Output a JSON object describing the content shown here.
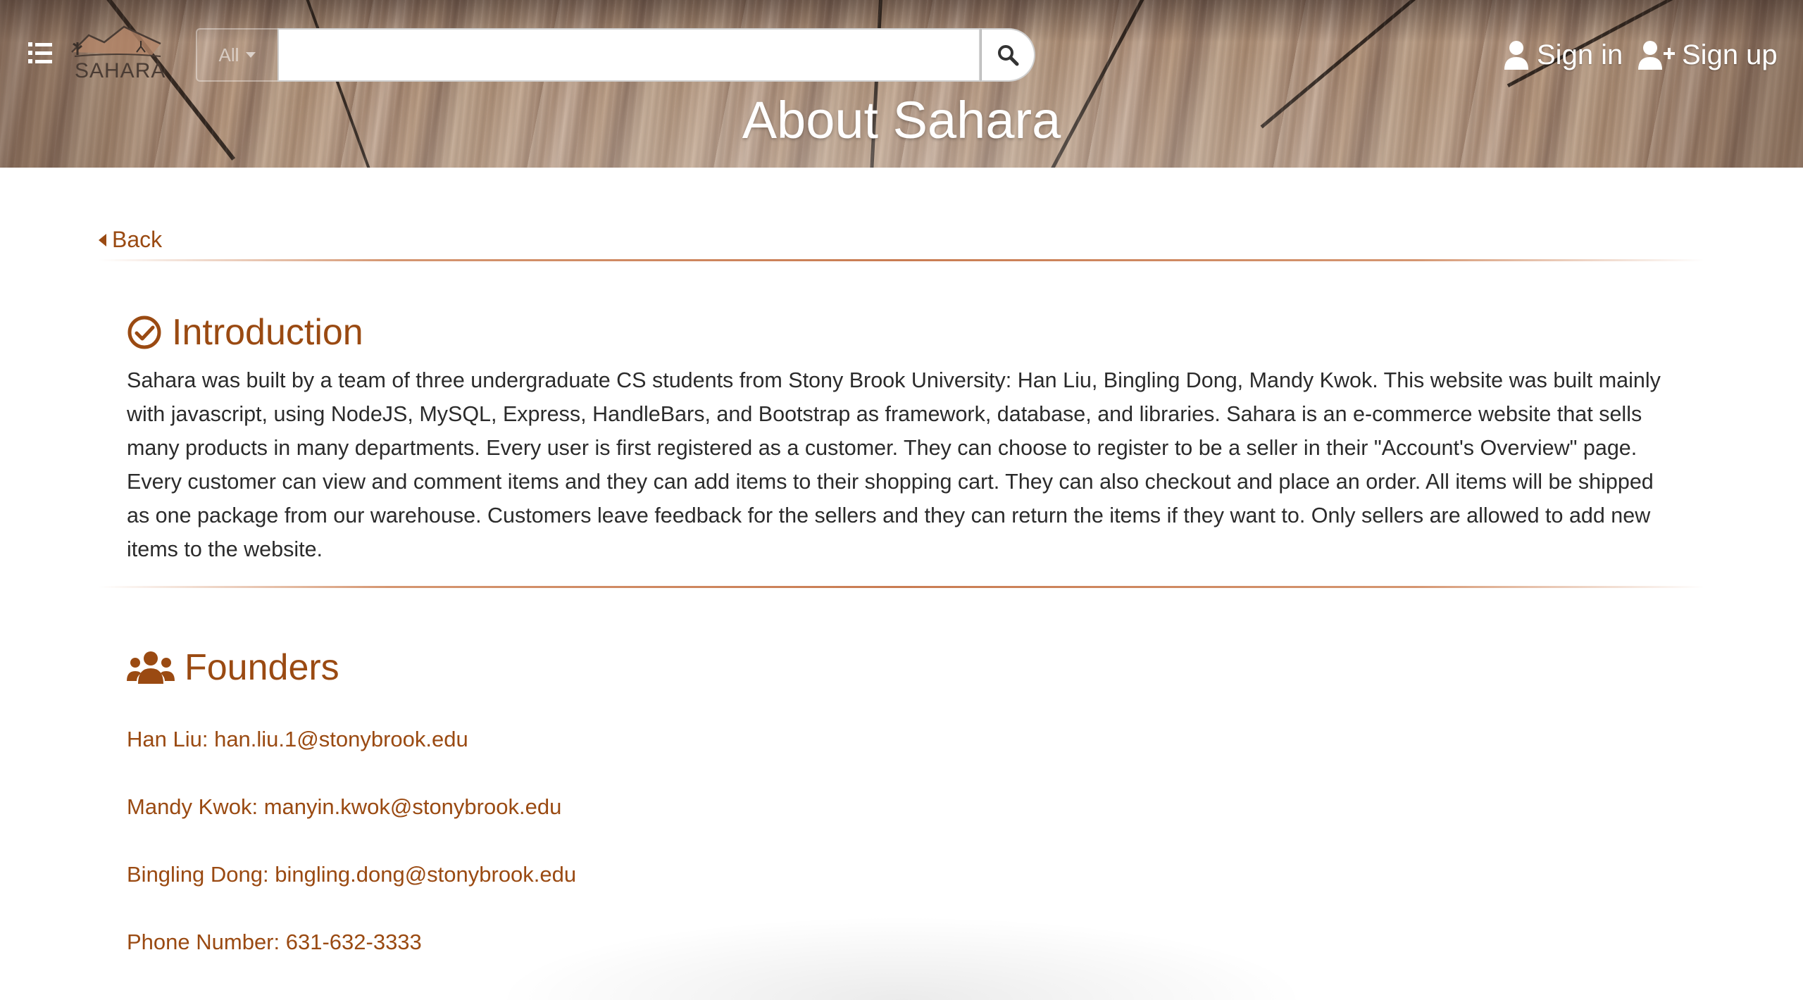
{
  "header": {
    "logo_text": "SAHARA",
    "department_select": {
      "selected": "All"
    },
    "search": {
      "value": "",
      "placeholder": ""
    },
    "sign_in_label": "Sign in",
    "sign_up_label": "Sign up",
    "page_title": "About Sahara"
  },
  "nav": {
    "back_label": "Back"
  },
  "introduction": {
    "heading": "Introduction",
    "body": "Sahara was built by a team of three undergraduate CS students from Stony Brook University: Han Liu, Bingling Dong, Mandy Kwok. This website was built mainly with javascript, using NodeJS, MySQL, Express, HandleBars, and Bootstrap as framework, database, and libraries. Sahara is an e-commerce website that sells many products in many departments. Every user is first registered as a customer. They can choose to register to be a seller in their \"Account's Overview\" page. Every customer can view and comment items and they can add items to their shopping cart. They can also checkout and place an order. All items will be shipped as one package from our warehouse. Customers leave feedback for the sellers and they can return the items if they want to. Only sellers are allowed to add new items to the website."
  },
  "founders": {
    "heading": "Founders",
    "lines": [
      "Han Liu: han.liu.1@stonybrook.edu",
      "Mandy Kwok: manyin.kwok@stonybrook.edu",
      "Bingling Dong: bingling.dong@stonybrook.edu",
      "Phone Number: 631-632-3333"
    ]
  },
  "colors": {
    "accent": "#9a4a12",
    "divider": "#c97c52",
    "body_text": "#2b2b2b",
    "header_text": "#ffffff"
  },
  "icons": {
    "menu": "list-icon",
    "search": "search-icon",
    "sign_in": "user-icon",
    "sign_up": "user-plus-icon",
    "back": "caret-left-icon",
    "introduction": "check-circle-icon",
    "founders": "users-icon"
  }
}
